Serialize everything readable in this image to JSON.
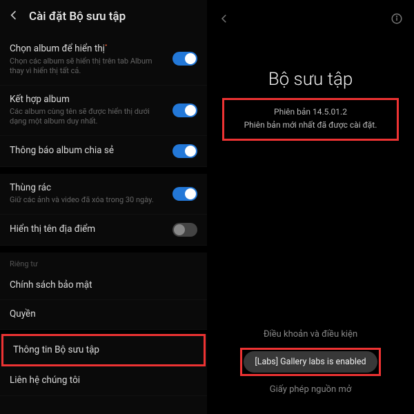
{
  "left": {
    "headerTitle": "Cài đặt Bộ sưu tập",
    "items": [
      {
        "title": "Chọn album để hiển thị",
        "marked": true,
        "subtitle": "Chọn các album sẽ hiển thị trên tab Album thay vì hiển thị tất cả.",
        "toggle": "on"
      },
      {
        "title": "Kết hợp album",
        "subtitle": "Các album cùng tên sẽ được hiển thị dưới dạng một album duy nhất.",
        "toggle": "on"
      },
      {
        "title": "Thông báo album chia sẻ",
        "toggle": "on"
      }
    ],
    "group2": [
      {
        "title": "Thùng rác",
        "subtitle": "Giữ các ảnh và video đã xóa trong 30 ngày.",
        "toggle": "on"
      },
      {
        "title": "Hiển thị tên địa điểm",
        "toggle": "off"
      }
    ],
    "privacyLabel": "Riêng tư",
    "group3": [
      {
        "title": "Chính sách bảo mật"
      },
      {
        "title": "Quyền"
      }
    ],
    "aboutTitle": "Thông tin Bộ sưu tập",
    "contactTitle": "Liên hệ chúng tôi"
  },
  "right": {
    "appName": "Bộ sưu tập",
    "versionLabel": "Phiên bản 14.5.01.2",
    "versionStatus": "Phiên bản mới nhất đã được cài đặt.",
    "termsLabel": "Điều khoản và điều kiện",
    "toastText": "[Labs] Gallery labs is enabled",
    "licenseLabel": "Giấy phép nguồn mở"
  }
}
